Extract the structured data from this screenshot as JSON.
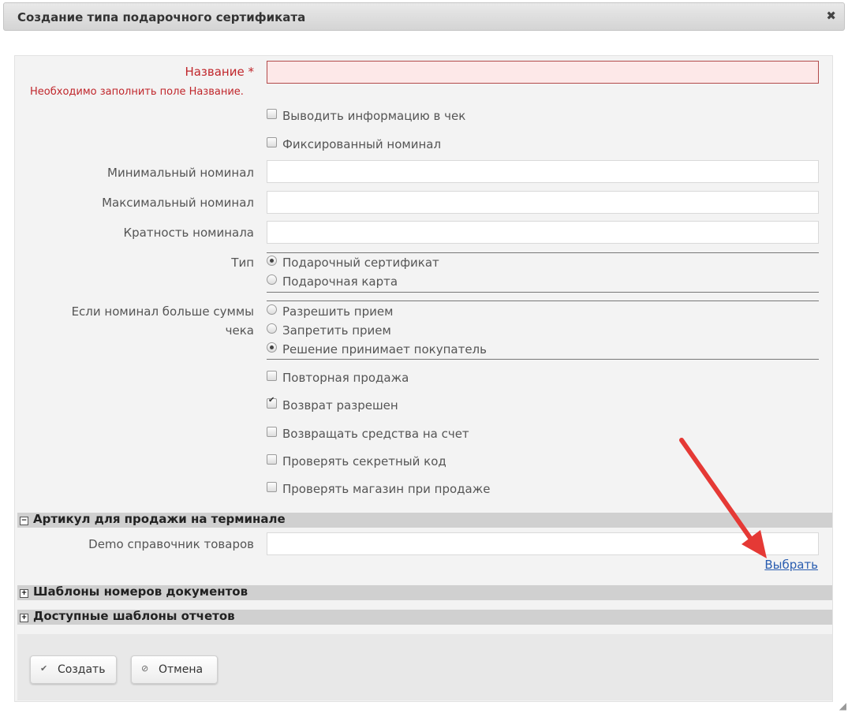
{
  "dialog": {
    "title": "Создание типа подарочного сертификата",
    "close_glyph": "✖"
  },
  "form": {
    "name_label": "Название *",
    "name_value": "",
    "name_error": "Необходимо заполнить поле Название.",
    "print_info_label": "Выводить информацию в чек",
    "fixed_nominal_label": "Фиксированный номинал",
    "min_nominal_label": "Минимальный номинал",
    "min_nominal_value": "",
    "max_nominal_label": "Максимальный номинал",
    "max_nominal_value": "",
    "multiplicity_label": "Кратность номинала",
    "multiplicity_value": "",
    "type_label": "Тип",
    "type_options": [
      "Подарочный сертификат",
      "Подарочная карта"
    ],
    "type_selected": "Подарочный сертификат",
    "overflow_label_line1": "Если номинал больше суммы",
    "overflow_label_line2": "чека",
    "overflow_options": [
      "Разрешить прием",
      "Запретить прием",
      "Решение принимает покупатель"
    ],
    "overflow_selected": "Решение принимает покупатель",
    "resale_label": "Повторная продажа",
    "resale_checked": false,
    "return_allowed_label": "Возврат разрешен",
    "return_allowed_checked": true,
    "refund_to_account_label": "Возвращать средства на счет",
    "refund_to_account_checked": false,
    "check_secret_label": "Проверять секретный код",
    "check_secret_checked": false,
    "check_store_label": "Проверять магазин при продаже",
    "check_store_checked": false
  },
  "sections": {
    "article": {
      "title": "Артикул для продажи на терминале",
      "toggle": "−",
      "directory_label": "Demo справочник товаров",
      "directory_value": "",
      "select_link": "Выбрать"
    },
    "doc_templates": {
      "title": "Шаблоны номеров документов",
      "toggle": "+"
    },
    "report_templates": {
      "title": "Доступные шаблоны отчетов",
      "toggle": "+"
    }
  },
  "footer": {
    "create_label": "Создать",
    "create_icon": "check-icon",
    "cancel_label": "Отмена",
    "cancel_icon": "cancel-icon"
  },
  "colors": {
    "error": "#c0262b",
    "invalid_bg": "#fde8e8",
    "link": "#2a5db0",
    "annotation_arrow": "#e53935"
  }
}
